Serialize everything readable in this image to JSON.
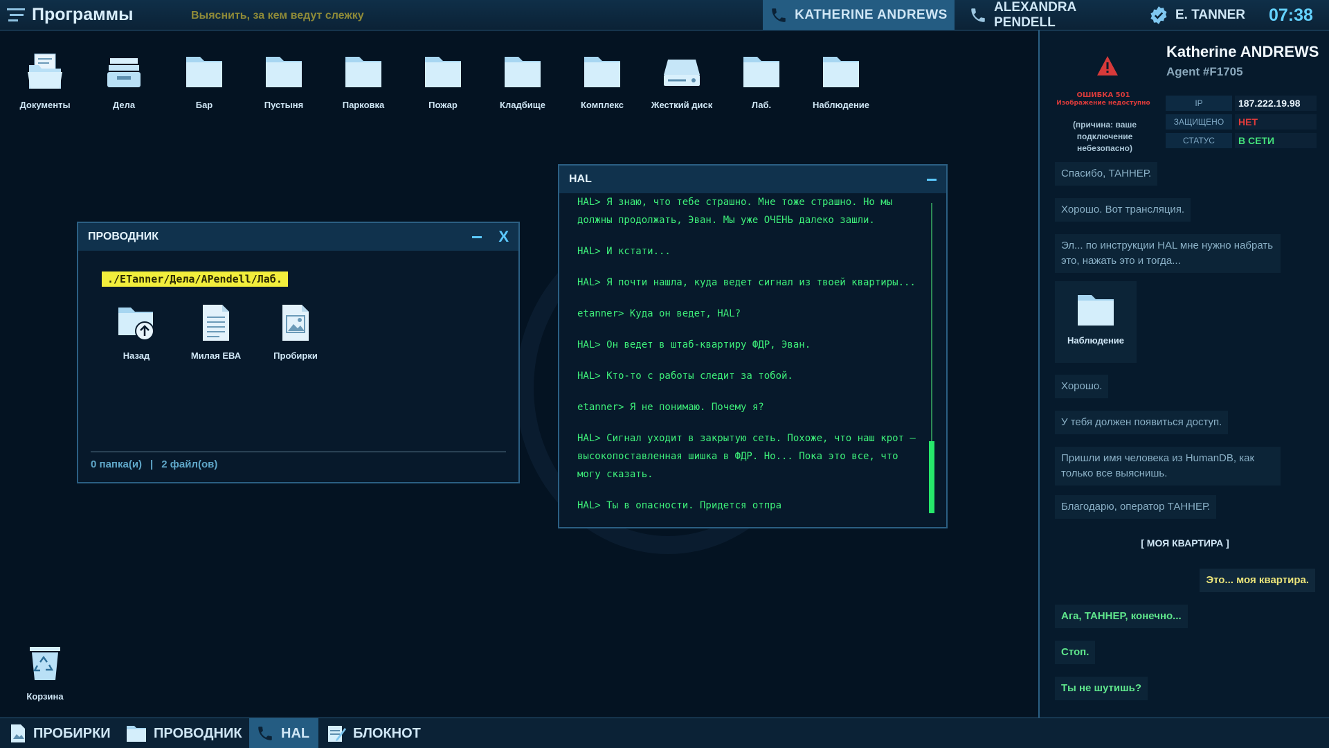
{
  "topbar": {
    "title": "Программы",
    "objective": "Выяснить, за кем ведут слежку",
    "calls": [
      {
        "label": "KATHERINE ANDREWS",
        "active": true
      },
      {
        "label": "ALEXANDRA PENDELL",
        "active": false
      }
    ],
    "user": "E. TANNER",
    "time": "07:38"
  },
  "desktop": {
    "icons": [
      {
        "label": "Документы",
        "icon": "documents-folder-icon"
      },
      {
        "label": "Дела",
        "icon": "cases-tray-icon"
      },
      {
        "label": "Бар",
        "icon": "folder-icon"
      },
      {
        "label": "Пустыня",
        "icon": "folder-icon"
      },
      {
        "label": "Парковка",
        "icon": "folder-icon"
      },
      {
        "label": "Пожар",
        "icon": "folder-icon"
      },
      {
        "label": "Кладбище",
        "icon": "folder-icon"
      },
      {
        "label": "Комплекс",
        "icon": "folder-icon"
      },
      {
        "label": "Жесткий диск",
        "icon": "hard-drive-icon"
      },
      {
        "label": "Лаб.",
        "icon": "folder-icon"
      },
      {
        "label": "Наблюдение",
        "icon": "folder-icon"
      }
    ],
    "trash": "Корзина"
  },
  "explorer": {
    "title": "ПРОВОДНИК",
    "path": "./ETanner/Дела/APendell/Лаб.",
    "items": [
      {
        "label": "Назад",
        "icon": "folder-up-icon"
      },
      {
        "label": "Милая ЕВА",
        "icon": "document-icon"
      },
      {
        "label": "Пробирки",
        "icon": "image-file-icon"
      }
    ],
    "status_folders": "0 папка(и)",
    "status_sep": "|",
    "status_files": "2 файл(ов)",
    "close_label": "X"
  },
  "hal": {
    "title": "HAL",
    "lines": [
      "HAL> Я знаю, что тебе страшно. Мне тоже страшно. Но мы должны продолжать, Эван. Мы уже ОЧЕНЬ далеко зашли.",
      "HAL> И кстати...",
      "HAL> Я почти нашла, куда ведет сигнал из твоей квартиры...",
      "etanner> Куда он ведет, HAL?",
      "HAL> Он ведет в штаб-квартиру ФДР, Эван.",
      "HAL> Кто-то с работы следит за тобой.",
      "etanner> Я не понимаю. Почему я?",
      "HAL> Сигнал уходит в закрытую сеть. Похоже, что наш крот — высокопоставленная шишка в ФДР. Но... Пока это все, что могу сказать.",
      "HAL> Ты в опасности. Придется отпра"
    ]
  },
  "contact": {
    "name": "Katherine ANDREWS",
    "agent_id": "Agent #F1705",
    "error_code": "ОШИБКА 501",
    "error_text": "Изображение недоступно",
    "error_reason": "(причина: ваше подключение небезопасно)",
    "info": [
      {
        "key": "IP",
        "value": "187.222.19.98",
        "color": "#e8f3fa"
      },
      {
        "key": "ЗАЩИЩЕНО",
        "value": "НЕТ",
        "color": "#e03b3b"
      },
      {
        "key": "СТАТУС",
        "value": "В СЕТИ",
        "color": "#44e07a"
      }
    ]
  },
  "chat": {
    "messages": [
      "Спасибо, ТАННЕР.",
      "Хорошо. Вот трансляция.",
      "Эл... по инструкции HAL мне нужно набрать это, нажать это и тогда...",
      "Хорошо.",
      "У тебя должен появиться доступ.",
      "Пришли имя человека из HumanDB, как только все выяснишь.",
      "Благодарю, оператор ТАННЕР."
    ],
    "shared_folder": "Наблюдение",
    "choice": "[   МОЯ КВАРТИРА   ]",
    "reply": "Это... моя квартира.",
    "later_messages": [
      "Ага, ТАННЕР, конечно...",
      "Стоп.",
      "Ты не шутишь?"
    ]
  },
  "taskbar": [
    {
      "label": "ПРОБИРКИ",
      "icon": "image-file-icon",
      "active": false
    },
    {
      "label": "ПРОВОДНИК",
      "icon": "folder-icon",
      "active": false
    },
    {
      "label": "HAL",
      "icon": "phone-icon",
      "active": true
    },
    {
      "label": "БЛОКНОТ",
      "icon": "notepad-icon",
      "active": false
    }
  ],
  "colors": {
    "accent": "#5cc9ff",
    "terminal_green": "#3ef07a",
    "path_highlight": "#f2ee3c",
    "danger": "#e03b3b"
  }
}
